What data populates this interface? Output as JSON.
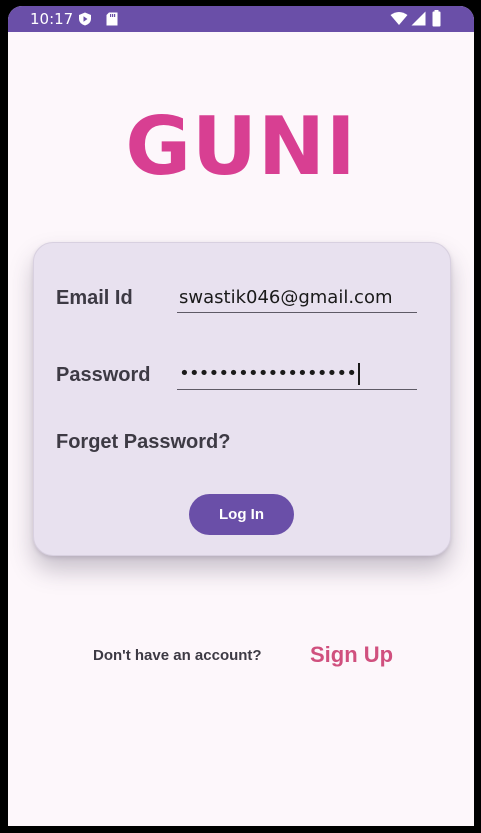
{
  "status_bar": {
    "time": "10:17",
    "background": "#6a4fa8",
    "icons_left": [
      "play-shield-icon",
      "sd-card-icon"
    ],
    "icons_right": [
      "wifi-icon",
      "signal-icon",
      "battery-icon"
    ]
  },
  "logo": {
    "text": "GUNI",
    "color": "#d83f92"
  },
  "login_form": {
    "email_label": "Email Id",
    "email_value": "swastik046@gmail.com",
    "password_label": "Password",
    "password_masked": "••••••••••••••••••",
    "forgot_password": "Forget Password?",
    "login_button": "Log In",
    "accent": "#6a4fa8"
  },
  "signup": {
    "prompt": "Don't have an account?",
    "link": "Sign Up",
    "link_color": "#d0507e"
  }
}
